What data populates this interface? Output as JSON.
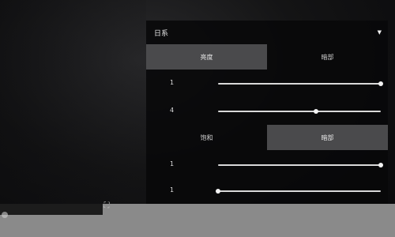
{
  "dropdown": {
    "value": "日系",
    "chevron_icon": "chevron-down-icon"
  },
  "group1": {
    "toggle": {
      "left_label": "亮度",
      "right_label": "暗部",
      "selected": "left"
    },
    "sliders": [
      {
        "value_label": "1",
        "level": 1.0
      },
      {
        "value_label": "4",
        "level": 0.6
      }
    ]
  },
  "group2": {
    "toggle": {
      "left_label": "饱和",
      "right_label": "暗部",
      "selected": "right"
    },
    "sliders": [
      {
        "value_label": "1",
        "level": 1.0
      },
      {
        "value_label": "1",
        "level": 0.0
      }
    ]
  },
  "colors": {
    "active_segment": "#4a4a4c",
    "track": "#d9d9d9",
    "bottom_bar": "#8a8a8a"
  }
}
